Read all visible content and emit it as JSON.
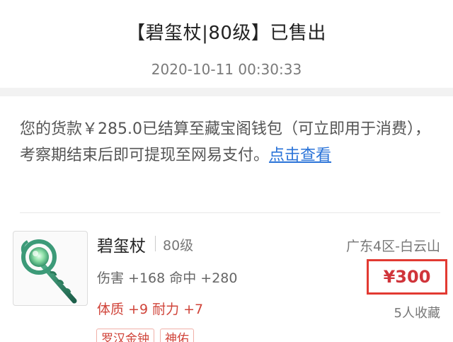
{
  "header": {
    "title": "【碧玺杖|80级】已售出",
    "timestamp": "2020-10-11 00:30:33"
  },
  "notice": {
    "text": "您的货款￥285.0已结算至藏宝阁钱包（可立即用于消费），考察期结束后即可提现至网易支付。",
    "link_label": "点击查看"
  },
  "item": {
    "icon": "jade-staff-icon",
    "name": "碧玺杖",
    "level": "80级",
    "stats": "伤害 +168 命中 +280",
    "bonus": "体质 +9 耐力 +7",
    "tags": [
      "罗汉金钟",
      "神佑"
    ],
    "server": "广东4区-白云山",
    "price": "¥300",
    "favorites": "5人收藏"
  },
  "colors": {
    "accent_red": "#d0343a",
    "price_highlight_border": "#e23a32",
    "link_blue": "#2a73d8"
  }
}
